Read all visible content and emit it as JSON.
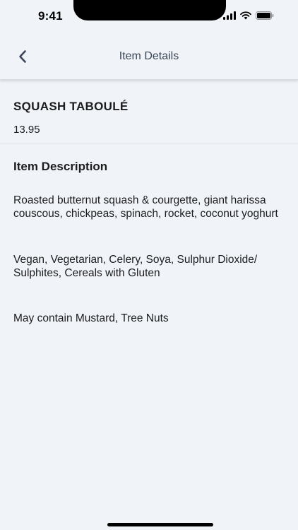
{
  "status_bar": {
    "time": "9:41",
    "icons": [
      "cellular-signal-icon",
      "wifi-icon",
      "battery-icon"
    ]
  },
  "nav": {
    "title": "Item Details",
    "back_icon": "chevron-left-icon"
  },
  "item": {
    "name": "SQUASH TABOULÉ",
    "price": "13.95"
  },
  "description": {
    "heading": "Item Description",
    "ingredients": "Roasted butternut squash & courgette, giant harissa couscous, chickpeas, spinach, rocket, coconut yoghurt",
    "dietary": "Vegan, Vegetarian, Celery, Soya, Sulphur Dioxide/ Sulphites, Cereals with Gluten",
    "may_contain": "May contain Mustard, Tree Nuts"
  },
  "colors": {
    "background": "#f0f4f8",
    "nav_title": "#3b4656",
    "text": "#1c1c1e"
  }
}
